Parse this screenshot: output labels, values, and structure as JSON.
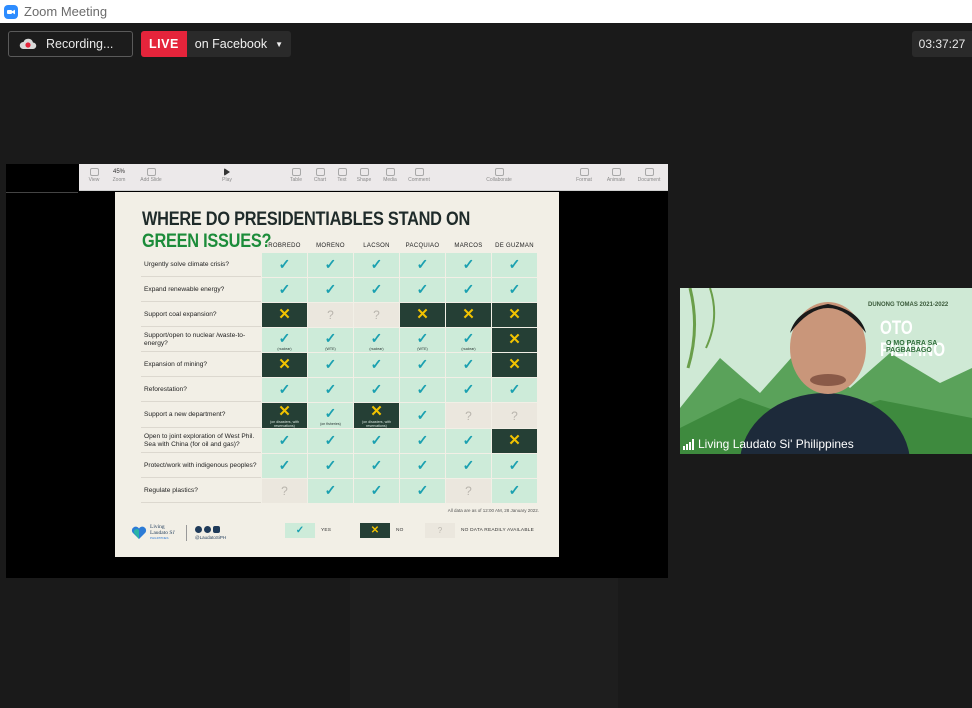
{
  "window": {
    "title": "Zoom Meeting"
  },
  "recording": {
    "label": "Recording..."
  },
  "live": {
    "badge": "LIVE",
    "destination": "on Facebook"
  },
  "timer": {
    "elapsed": "03:37:27"
  },
  "keynote_toolbar": {
    "items": [
      "View",
      "Zoom",
      "Add Slide",
      "Play",
      "Table",
      "Chart",
      "Text",
      "Shape",
      "Media",
      "Comment",
      "Collaborate",
      "Format",
      "Animate",
      "Document"
    ],
    "zoom_value": "45%"
  },
  "slide": {
    "title_part1": "WHERE DO PRESIDENTIABLES STAND ON ",
    "title_part2": "GREEN ISSUES?",
    "candidates": [
      "ROBREDO",
      "MORENO",
      "LACSON",
      "PACQUIAO",
      "MARCOS",
      "DE GUZMAN"
    ],
    "rows": [
      {
        "question": "Urgently solve climate crisis?",
        "cells": [
          {
            "s": "yes"
          },
          {
            "s": "yes"
          },
          {
            "s": "yes"
          },
          {
            "s": "yes"
          },
          {
            "s": "yes"
          },
          {
            "s": "yes"
          }
        ]
      },
      {
        "question": "Expand renewable energy?",
        "cells": [
          {
            "s": "yes"
          },
          {
            "s": "yes"
          },
          {
            "s": "yes"
          },
          {
            "s": "yes"
          },
          {
            "s": "yes"
          },
          {
            "s": "yes"
          }
        ]
      },
      {
        "question": "Support coal expansion?",
        "cells": [
          {
            "s": "no"
          },
          {
            "s": "nd"
          },
          {
            "s": "nd"
          },
          {
            "s": "no"
          },
          {
            "s": "no"
          },
          {
            "s": "no"
          }
        ]
      },
      {
        "question": "Support/open to nuclear /waste-to-energy?",
        "cells": [
          {
            "s": "yes",
            "note": "(nuclear)"
          },
          {
            "s": "yes",
            "note": "(WTE)"
          },
          {
            "s": "yes",
            "note": "(nuclear)"
          },
          {
            "s": "yes",
            "note": "(WTE)"
          },
          {
            "s": "yes",
            "note": "(nuclear)"
          },
          {
            "s": "no"
          }
        ]
      },
      {
        "question": "Expansion of mining?",
        "cells": [
          {
            "s": "no"
          },
          {
            "s": "yes"
          },
          {
            "s": "yes"
          },
          {
            "s": "yes"
          },
          {
            "s": "yes"
          },
          {
            "s": "no"
          }
        ]
      },
      {
        "question": "Reforestation?",
        "cells": [
          {
            "s": "yes"
          },
          {
            "s": "yes"
          },
          {
            "s": "yes"
          },
          {
            "s": "yes"
          },
          {
            "s": "yes"
          },
          {
            "s": "yes"
          }
        ]
      },
      {
        "question": "Support a new department?",
        "cells": [
          {
            "s": "no",
            "note": "(on disasters, with reservations)"
          },
          {
            "s": "yes",
            "note": "(on fisheries)"
          },
          {
            "s": "no",
            "note": "(on disasters, with reservations)"
          },
          {
            "s": "yes"
          },
          {
            "s": "nd"
          },
          {
            "s": "nd"
          }
        ]
      },
      {
        "question": "Open to joint exploration of West Phil. Sea with China (for oil and gas)?",
        "cells": [
          {
            "s": "yes"
          },
          {
            "s": "yes"
          },
          {
            "s": "yes"
          },
          {
            "s": "yes"
          },
          {
            "s": "yes"
          },
          {
            "s": "no"
          }
        ]
      },
      {
        "question": "Protect/work with indigenous peoples?",
        "cells": [
          {
            "s": "yes"
          },
          {
            "s": "yes"
          },
          {
            "s": "yes"
          },
          {
            "s": "yes"
          },
          {
            "s": "yes"
          },
          {
            "s": "yes"
          }
        ]
      },
      {
        "question": "Regulate plastics?",
        "cells": [
          {
            "s": "nd"
          },
          {
            "s": "yes"
          },
          {
            "s": "yes"
          },
          {
            "s": "yes"
          },
          {
            "s": "nd"
          },
          {
            "s": "yes"
          }
        ]
      }
    ],
    "as_of": "All data are as of 12:00 AM, 28 January 2022.",
    "legend": {
      "yes": "YES",
      "no": "NO",
      "nd": "NO DATA READILY AVAILABLE"
    },
    "brand_name": "Living Laudato Si'",
    "brand_sub": "PHILIPPINES",
    "handle": "@LaudatoSiPH"
  },
  "participant": {
    "name": "Living Laudato Si' Philippines",
    "bg_text_1": "DUNONG TOMAS 2021-2022",
    "bg_text_2": "OTO PILIPINO",
    "bg_text_3": "O MO PARA SA PAGBABAGO"
  }
}
